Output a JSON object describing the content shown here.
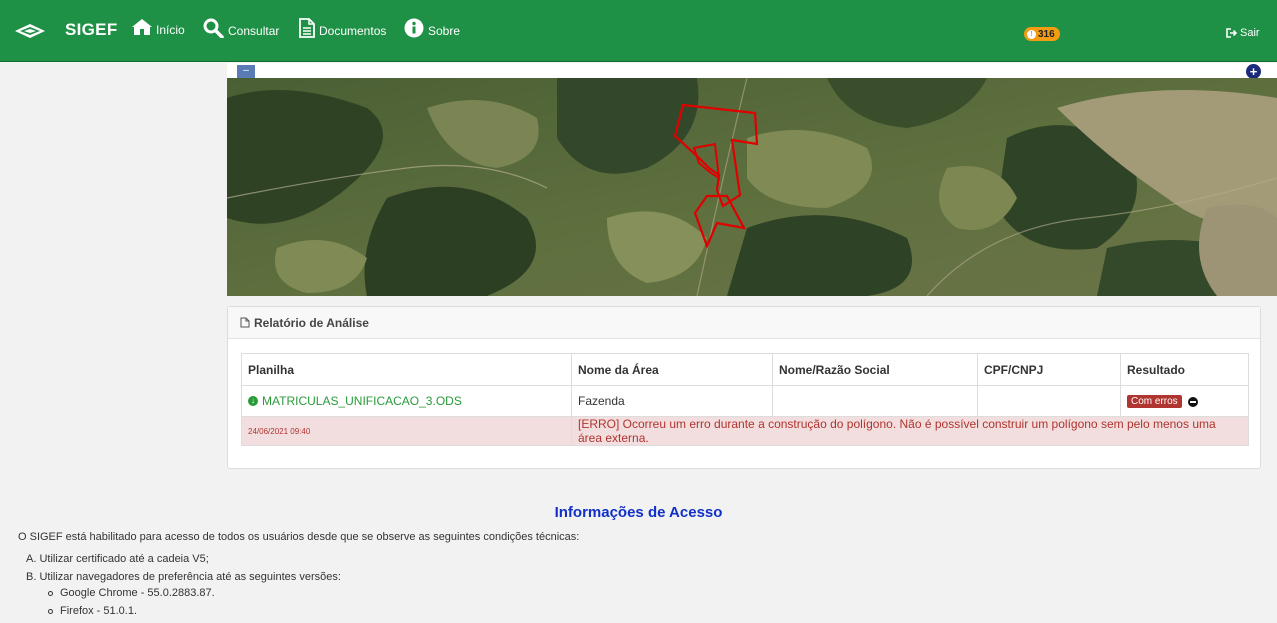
{
  "nav": {
    "brand": "SIGEF",
    "items": [
      {
        "label": "Início",
        "icon": "home-icon"
      },
      {
        "label": "Consultar",
        "icon": "search-icon"
      },
      {
        "label": "Documentos",
        "icon": "document-icon"
      },
      {
        "label": "Sobre",
        "icon": "info-icon"
      }
    ],
    "notification_count": "316",
    "logout_label": "Sair"
  },
  "map": {
    "zoom_out": "–",
    "zoom_in": "+"
  },
  "report": {
    "title": "Relatório de Análise",
    "columns": [
      "Planilha",
      "Nome da Área",
      "Nome/Razão Social",
      "CPF/CNPJ",
      "Resultado"
    ],
    "row": {
      "file": "MATRICULAS_UNIFICACAO_3.ODS",
      "area_name": "Fazenda",
      "owner": "",
      "cpf_cnpj": "",
      "result": "Com erros"
    },
    "error": {
      "timestamp": "24/06/2021 09:40",
      "message": "[ERRO] Ocorreu um erro durante a construção do polígono. Não é possível construir um polígono sem pelo menos uma área externa."
    }
  },
  "info": {
    "title": "Informações de Acesso",
    "intro": "O SIGEF está habilitado para acesso de todos os usuários desde que se observe as seguintes condições técnicas:",
    "items": [
      "A. Utilizar certificado até a cadeia V5;",
      "B. Utilizar navegadores de preferência até as seguintes versões:"
    ],
    "browsers": [
      "Google Chrome - 55.0.2883.87.",
      "Firefox - 51.0.1."
    ]
  },
  "colors": {
    "nav_bg": "#1f9147",
    "badge": "#f39c12",
    "error_bg": "#f2dede",
    "error_text": "#b0342f",
    "info_title": "#1030c8"
  }
}
